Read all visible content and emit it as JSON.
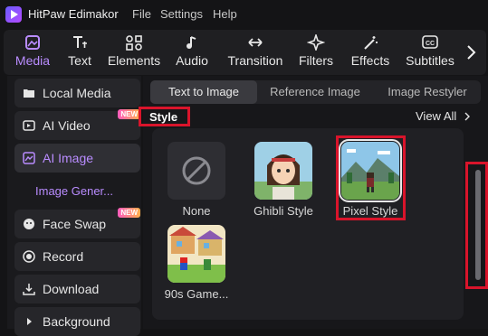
{
  "app": {
    "name": "HitPaw Edimakor",
    "logo": "play-icon",
    "accent": "#b98cff",
    "highlight": "#d9142b"
  },
  "menu": [
    "File",
    "Settings",
    "Help"
  ],
  "toolbar": {
    "tabs": [
      {
        "label": "Media",
        "icon": "media-icon"
      },
      {
        "label": "Text",
        "icon": "text-icon"
      },
      {
        "label": "Elements",
        "icon": "elements-icon"
      },
      {
        "label": "Audio",
        "icon": "music-note-icon"
      },
      {
        "label": "Transition",
        "icon": "transition-arrows-icon"
      },
      {
        "label": "Filters",
        "icon": "sparkle-icon"
      },
      {
        "label": "Effects",
        "icon": "effects-wand-icon"
      },
      {
        "label": "Subtitles",
        "icon": "cc-icon"
      }
    ],
    "active": "Media"
  },
  "sidebar": {
    "items": [
      {
        "label": "Local Media",
        "icon": "folder-icon"
      },
      {
        "label": "AI Video",
        "icon": "video-play-icon",
        "badge": "NEW"
      },
      {
        "label": "AI Image",
        "icon": "image-icon"
      },
      {
        "label": "Face Swap",
        "icon": "face-icon",
        "badge": "NEW"
      },
      {
        "label": "Record",
        "icon": "record-icon"
      },
      {
        "label": "Download",
        "icon": "download-icon"
      },
      {
        "label": "Background",
        "icon": "chevron-right-icon"
      }
    ],
    "sub_item": "Image Gener...",
    "active": "AI Image"
  },
  "tabs": [
    "Text to Image",
    "Reference Image",
    "Image Restyler"
  ],
  "active_tab": "Text to Image",
  "section": {
    "title": "Style",
    "view_all": "View All"
  },
  "styles": [
    {
      "label": "None"
    },
    {
      "label": "Ghibli Style"
    },
    {
      "label": "Pixel Style",
      "selected": true
    },
    {
      "label": "90s Game..."
    }
  ]
}
